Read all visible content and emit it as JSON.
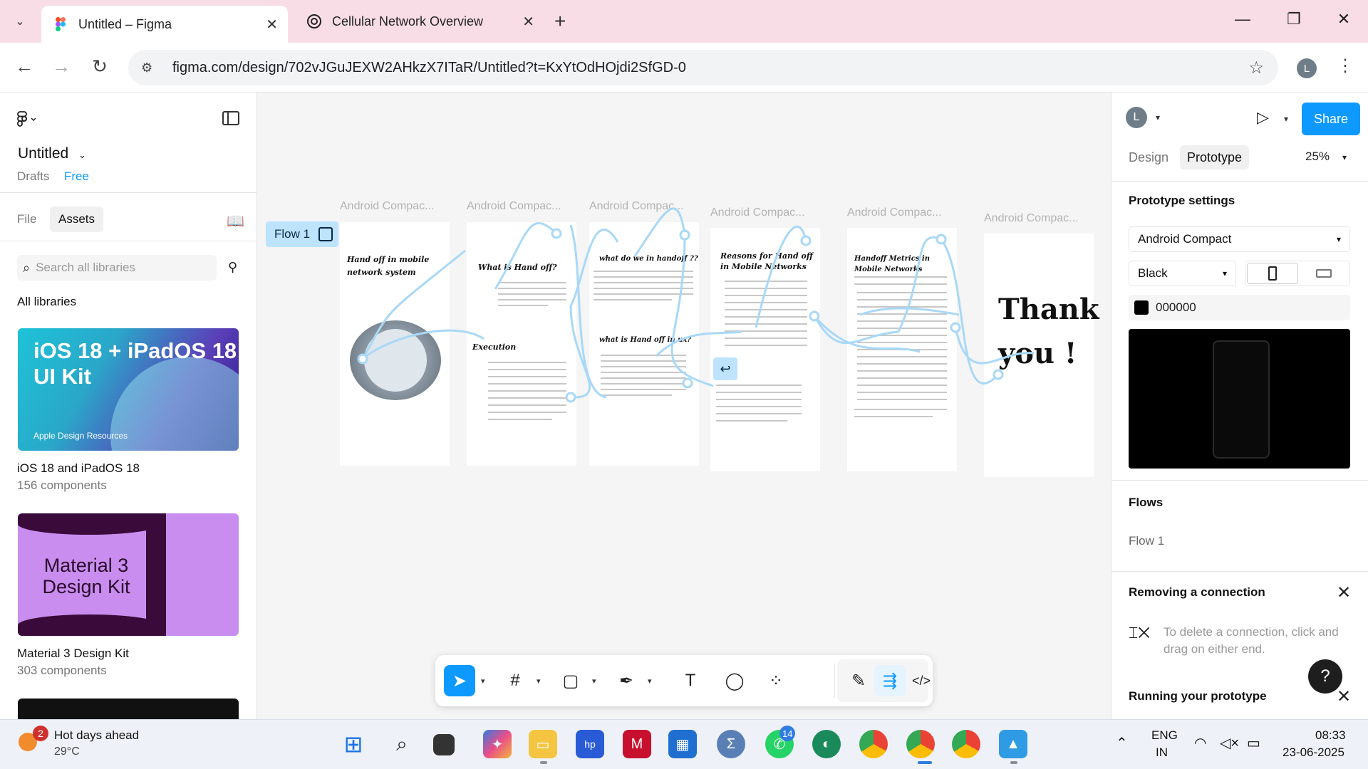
{
  "browser": {
    "tabs": [
      {
        "title": "Untitled – Figma"
      },
      {
        "title": "Cellular Network Overview"
      }
    ],
    "url": "figma.com/design/702vJGuJEXW2AHkzX7ITaR/Untitled?t=KxYtOdHOjdi2SfGD-0",
    "profile_initial": "L"
  },
  "left_panel": {
    "file_title": "Untitled",
    "drafts_label": "Drafts",
    "plan_label": "Free",
    "tabs": [
      {
        "label": "File"
      },
      {
        "label": "Assets"
      }
    ],
    "search_placeholder": "Search all libraries",
    "all_libraries_label": "All libraries",
    "libraries": [
      {
        "name": "iOS 18 and iPadOS 18",
        "count": "156 components",
        "thumb_title": "iOS 18 + iPadOS 18 UI Kit",
        "thumb_footer": "Apple Design Resources"
      },
      {
        "name": "Material 3 Design Kit",
        "count": "303 components",
        "thumb_title": "Material 3 Design Kit"
      }
    ]
  },
  "canvas": {
    "flow_label": "Flow 1",
    "frame_labels": [
      "Android Compac...",
      "Android Compac...",
      "Android Compac...",
      "Android Compac...",
      "Android Compac...",
      "Android Compac..."
    ],
    "frames": {
      "f1_title": "Hand off in mobile network system",
      "f2_title": "What is Hand off?",
      "f2_subtitle": "Execution",
      "f3_title": "what do we in handoff ??",
      "f3_subtitle": "what is Hand off in ux?",
      "f4_title": "Reasons for Hand off in Mobile Networks",
      "f5_title": "Handoff Metrics in Mobile Networks",
      "f6_title": "Thank you !"
    }
  },
  "toolbar": {
    "tools": [
      "move-tool",
      "frame-tool",
      "shape-tool",
      "pen-tool",
      "text-tool",
      "comment-tool",
      "actions-tool",
      "draw-mode",
      "prototype-mode",
      "dev-mode"
    ]
  },
  "right_panel": {
    "avatar_initial": "L",
    "share_label": "Share",
    "tabs": [
      {
        "label": "Design"
      },
      {
        "label": "Prototype"
      }
    ],
    "zoom": "25%",
    "prototype_settings_label": "Prototype settings",
    "device": "Android Compact",
    "device_color": "Black",
    "background_hex": "000000",
    "flows_label": "Flows",
    "flow_item": "Flow 1",
    "removing_title": "Removing a connection",
    "removing_text": "To delete a connection, click and drag on either end.",
    "running_title": "Running your prototype",
    "help_label": "?"
  },
  "taskbar": {
    "weather_title": "Hot days ahead",
    "weather_temp": "29°C",
    "weather_badge": "2",
    "whatsapp_badge": "14",
    "language": "ENG",
    "region": "IN",
    "time": "08:33",
    "date": "23-06-2025"
  },
  "colors": {
    "tabbar_bg": "#f9dde6",
    "accent": "#0d99ff",
    "flow_blue": "#bde3ff",
    "canvas_bg": "#f5f5f5"
  }
}
